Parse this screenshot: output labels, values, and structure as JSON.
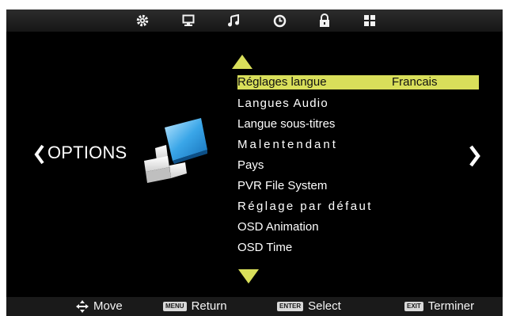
{
  "top_icons": [
    {
      "name": "setup-gear-icon"
    },
    {
      "name": "monitor-icon"
    },
    {
      "name": "music-note-icon"
    },
    {
      "name": "clock-icon"
    },
    {
      "name": "lock-icon"
    },
    {
      "name": "grid-icon"
    }
  ],
  "section": {
    "title": "OPTIONS"
  },
  "menu": {
    "items": [
      {
        "label": "Réglages langue",
        "value": "Francais",
        "selected": true
      },
      {
        "label": "Langues Audio"
      },
      {
        "label": "Langue sous-titres"
      },
      {
        "label": "Malentendant"
      },
      {
        "label": "Pays"
      },
      {
        "label": "PVR File System"
      },
      {
        "label": "Réglage par défaut"
      },
      {
        "label": "OSD Animation"
      },
      {
        "label": "OSD Time"
      }
    ]
  },
  "footer": {
    "move_label": "Move",
    "menu_key": "MENU",
    "return_label": "Return",
    "enter_key": "ENTER",
    "select_label": "Select",
    "exit_key": "EXIT",
    "exit_label": "Terminer"
  },
  "colors": {
    "selection": "#d9df5a",
    "arrow": "#d9df5a",
    "background": "#000000",
    "text": "#ffffff"
  }
}
